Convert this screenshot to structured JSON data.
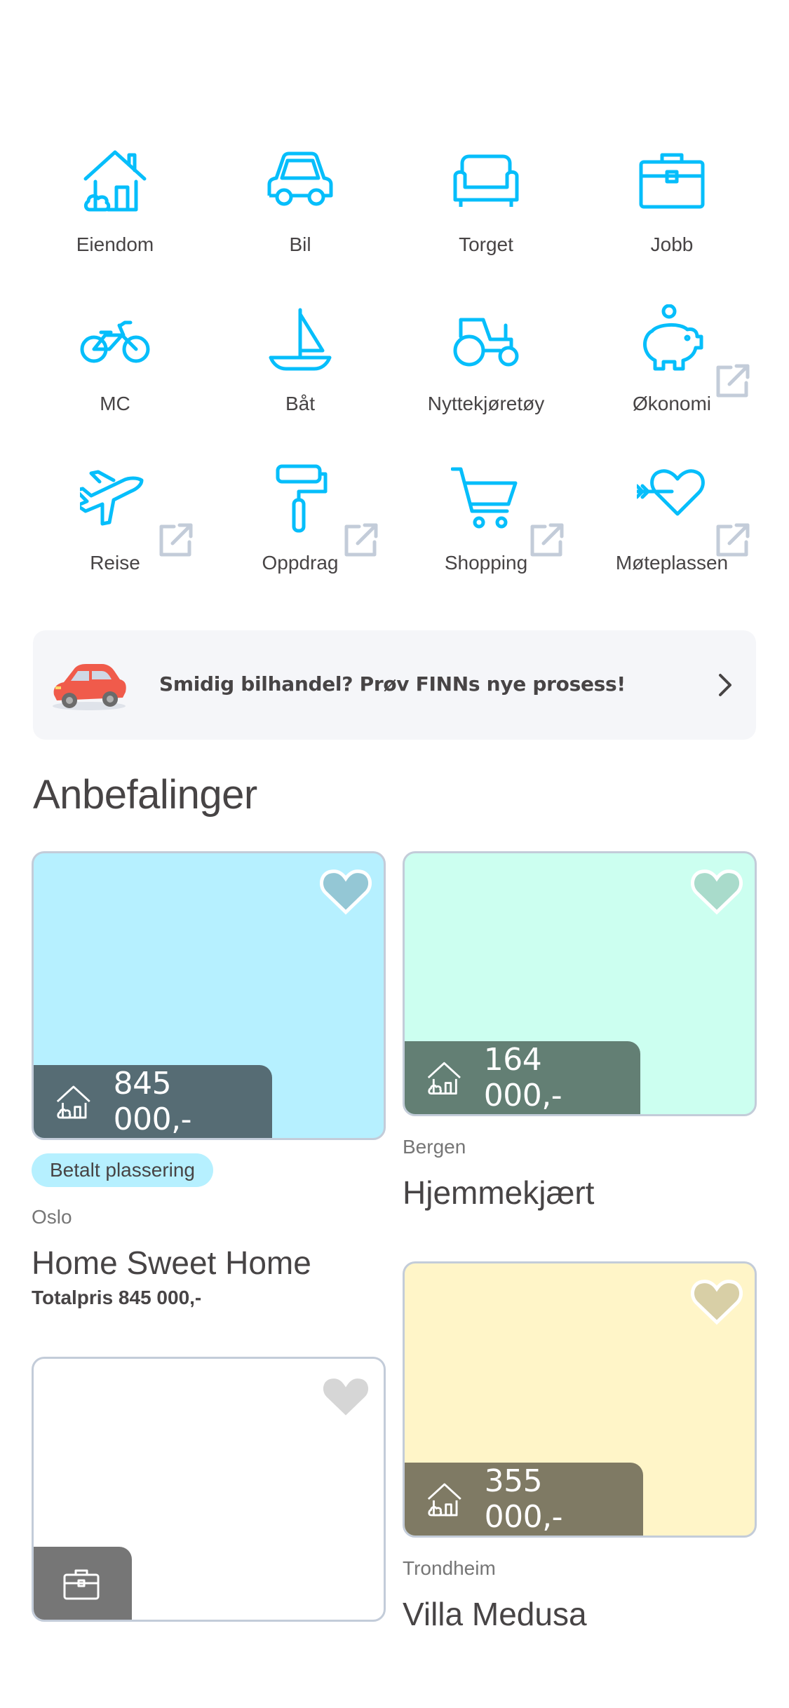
{
  "categories": [
    {
      "label": "Eiendom",
      "icon": "house-icon",
      "external": false
    },
    {
      "label": "Bil",
      "icon": "car-icon",
      "external": false
    },
    {
      "label": "Torget",
      "icon": "sofa-icon",
      "external": false
    },
    {
      "label": "Jobb",
      "icon": "briefcase-icon",
      "external": false
    },
    {
      "label": "MC",
      "icon": "motorcycle-icon",
      "external": false
    },
    {
      "label": "Båt",
      "icon": "sailboat-icon",
      "external": false
    },
    {
      "label": "Nyttekjøretøy",
      "icon": "tractor-icon",
      "external": false
    },
    {
      "label": "Økonomi",
      "icon": "piggy-bank-icon",
      "external": true
    },
    {
      "label": "Reise",
      "icon": "airplane-icon",
      "external": true
    },
    {
      "label": "Oppdrag",
      "icon": "paint-roller-icon",
      "external": true
    },
    {
      "label": "Shopping",
      "icon": "shopping-cart-icon",
      "external": true
    },
    {
      "label": "Møteplassen",
      "icon": "heart-arrow-icon",
      "external": true
    }
  ],
  "banner": {
    "text": "Smidig bilhandel? Prøv FINNs nye prosess!",
    "icon": "red-car-illustration"
  },
  "section_title": "Anbefalinger",
  "ads": [
    {
      "price": "845 000,-",
      "badge": "Betalt plassering",
      "location": "Oslo",
      "title": "Home Sweet Home",
      "total": "Totalpris 845 000,-",
      "bg": "#b6f0ff",
      "price_bg": "#566c74"
    },
    {
      "price": "164 000,-",
      "location": "Bergen",
      "title": "Hjemmekjært",
      "bg": "#ccfff0",
      "price_bg": "#637f74"
    },
    {
      "price": "355 000,-",
      "location": "Trondheim",
      "title": "Villa Medusa",
      "bg": "#fff5c8",
      "price_bg": "#7f7a64"
    },
    {
      "bg": "#ffffff",
      "tag_icon": "briefcase-icon"
    }
  ],
  "colors": {
    "accent": "#06befb",
    "text": "#474445",
    "muted": "#767676",
    "external": "#c3ccd9"
  }
}
